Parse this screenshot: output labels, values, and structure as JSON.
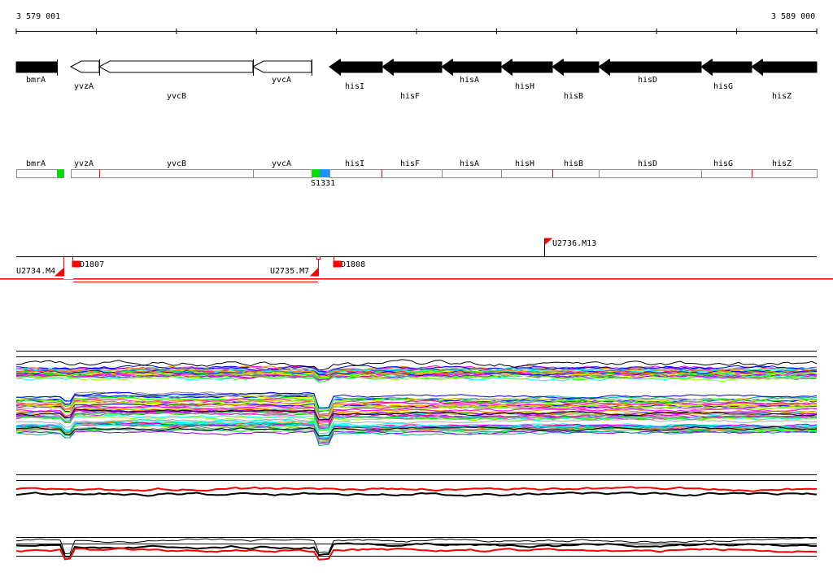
{
  "ruler": {
    "start": "3 579 001",
    "end": "3 589 000"
  },
  "genes": [
    {
      "name": "bmrA",
      "strand": "+"
    },
    {
      "name": "yvzA",
      "strand": "-"
    },
    {
      "name": "yvcB",
      "strand": "-"
    },
    {
      "name": "yvcA",
      "strand": "-"
    },
    {
      "name": "hisI",
      "strand": "-"
    },
    {
      "name": "hisF",
      "strand": "-"
    },
    {
      "name": "hisA",
      "strand": "-"
    },
    {
      "name": "hisH",
      "strand": "-"
    },
    {
      "name": "hisB",
      "strand": "-"
    },
    {
      "name": "hisD",
      "strand": "-"
    },
    {
      "name": "hisG",
      "strand": "-"
    },
    {
      "name": "hisZ",
      "strand": "-"
    }
  ],
  "segments": {
    "marker": "S1331"
  },
  "features": [
    "U2734.M4",
    "D1807",
    "U2735.M7",
    "D1808",
    "U2736.M13"
  ],
  "colors": {
    "accent": "#ff0000",
    "green": "#00dd00",
    "blue": "#1e90ff"
  }
}
